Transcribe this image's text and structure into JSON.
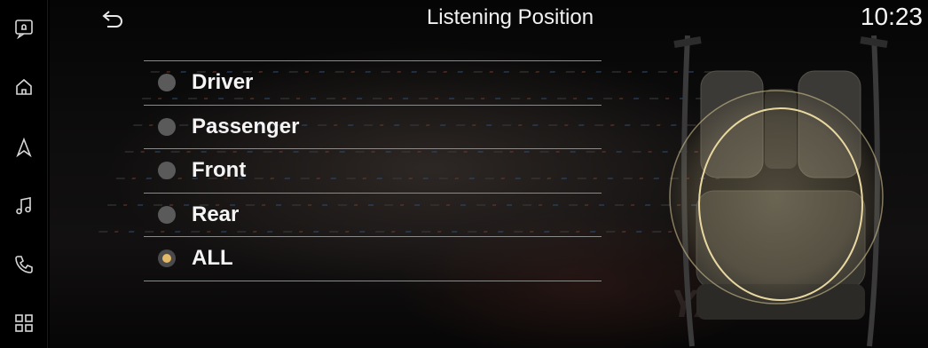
{
  "header": {
    "title": "Listening Position",
    "clock": "10:23"
  },
  "rail": {
    "items": [
      {
        "icon": "notification-icon"
      },
      {
        "icon": "home-icon"
      },
      {
        "icon": "navigation-icon"
      },
      {
        "icon": "music-icon"
      },
      {
        "icon": "phone-icon"
      },
      {
        "icon": "apps-grid-icon"
      }
    ]
  },
  "options": [
    {
      "label": "Driver",
      "selected": false
    },
    {
      "label": "Passenger",
      "selected": false
    },
    {
      "label": "Front",
      "selected": false
    },
    {
      "label": "Rear",
      "selected": false
    },
    {
      "label": "ALL",
      "selected": true
    }
  ],
  "background": {
    "watermark": "YAMAHA"
  },
  "colors": {
    "accent": "#e5b96a",
    "divider": "#8a8a8a"
  }
}
